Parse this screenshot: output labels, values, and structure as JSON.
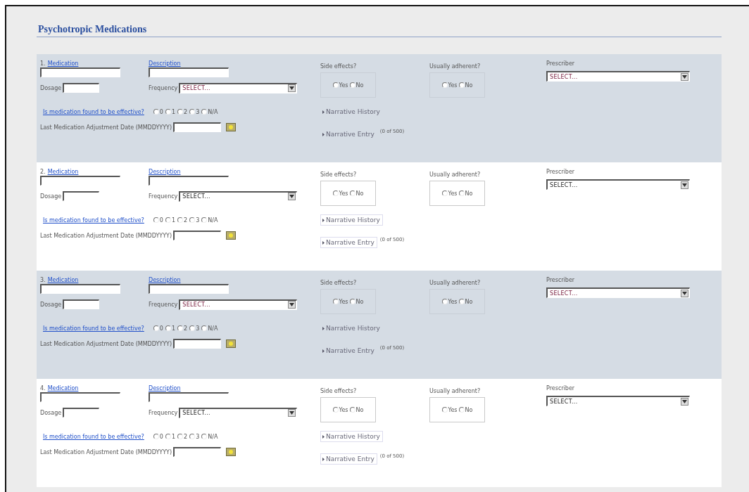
{
  "title": "Psychotropic Medications",
  "rows": [
    {
      "number": "1.",
      "shaded": true,
      "medication_label": "Medication",
      "description_label": "Description",
      "dosage_label": "Dosage",
      "frequency_label": "Frequency",
      "frequency_value": "SELECT...",
      "effective_question": "Is medication found to be effective?",
      "effective_options": [
        {
          "label": "0",
          "selected": false
        },
        {
          "label": "1",
          "selected": false
        },
        {
          "label": "2",
          "selected": false
        },
        {
          "label": "3",
          "selected": false
        },
        {
          "label": "N/A",
          "selected": false
        }
      ],
      "date_label": "Last Medication Adjustment Date (MMDDYYYY)",
      "side_effects_label": "Side effects?",
      "side_effects_options": [
        {
          "label": "Yes",
          "selected": false
        },
        {
          "label": "No",
          "selected": false
        }
      ],
      "adherent_label": "Usually adherent?",
      "adherent_options": [
        {
          "label": "Yes",
          "selected": false
        },
        {
          "label": "No",
          "selected": false
        }
      ],
      "prescriber_label": "Prescriber",
      "prescriber_value": "SELECT...",
      "narrative_history": "Narrative History",
      "narrative_entry": "Narrative Entry",
      "entry_count": "(0 of 500)"
    },
    {
      "number": "2.",
      "shaded": false,
      "medication_label": "Medication",
      "description_label": "Description",
      "dosage_label": "Dosage",
      "frequency_label": "Frequency",
      "frequency_value": "SELECT...",
      "effective_question": "Is medication found to be effective?",
      "effective_options": [
        {
          "label": "0",
          "selected": false
        },
        {
          "label": "1",
          "selected": false
        },
        {
          "label": "2",
          "selected": false
        },
        {
          "label": "3",
          "selected": false
        },
        {
          "label": "N/A",
          "selected": false
        }
      ],
      "date_label": "Last Medication Adjustment Date (MMDDYYYY)",
      "side_effects_label": "Side effects?",
      "side_effects_options": [
        {
          "label": "Yes",
          "selected": false
        },
        {
          "label": "No",
          "selected": false
        }
      ],
      "adherent_label": "Usually adherent?",
      "adherent_options": [
        {
          "label": "Yes",
          "selected": false
        },
        {
          "label": "No",
          "selected": false
        }
      ],
      "prescriber_label": "Prescriber",
      "prescriber_value": "SELECT...",
      "narrative_history": "Narrative History",
      "narrative_entry": "Narrative Entry",
      "entry_count": "(0 of 500)"
    },
    {
      "number": "3.",
      "shaded": true,
      "medication_label": "Medication",
      "description_label": "Description",
      "dosage_label": "Dosage",
      "frequency_label": "Frequency",
      "frequency_value": "SELECT...",
      "effective_question": "Is medication found to be effective?",
      "effective_options": [
        {
          "label": "0",
          "selected": false
        },
        {
          "label": "1",
          "selected": false
        },
        {
          "label": "2",
          "selected": false
        },
        {
          "label": "3",
          "selected": false
        },
        {
          "label": "N/A",
          "selected": false
        }
      ],
      "date_label": "Last Medication Adjustment Date (MMDDYYYY)",
      "side_effects_label": "Side effects?",
      "side_effects_options": [
        {
          "label": "Yes",
          "selected": false
        },
        {
          "label": "No",
          "selected": false
        }
      ],
      "adherent_label": "Usually adherent?",
      "adherent_options": [
        {
          "label": "Yes",
          "selected": false
        },
        {
          "label": "No",
          "selected": false
        }
      ],
      "prescriber_label": "Prescriber",
      "prescriber_value": "SELECT...",
      "narrative_history": "Narrative History",
      "narrative_entry": "Narrative Entry",
      "entry_count": "(0 of 500)"
    },
    {
      "number": "4.",
      "shaded": false,
      "medication_label": "Medication",
      "description_label": "Description",
      "dosage_label": "Dosage",
      "frequency_label": "Frequency",
      "frequency_value": "SELECT...",
      "effective_question": "Is medication found to be effective?",
      "effective_options": [
        {
          "label": "0",
          "selected": false
        },
        {
          "label": "1",
          "selected": false
        },
        {
          "label": "2",
          "selected": false
        },
        {
          "label": "3",
          "selected": false
        },
        {
          "label": "N/A",
          "selected": false
        }
      ],
      "date_label": "Last Medication Adjustment Date (MMDDYYYY)",
      "side_effects_label": "Side effects?",
      "side_effects_options": [
        {
          "label": "Yes",
          "selected": false
        },
        {
          "label": "No",
          "selected": false
        }
      ],
      "adherent_label": "Usually adherent?",
      "adherent_options": [
        {
          "label": "Yes",
          "selected": false
        },
        {
          "label": "No",
          "selected": false
        }
      ],
      "prescriber_label": "Prescriber",
      "prescriber_value": "SELECT...",
      "narrative_history": "Narrative History",
      "narrative_entry": "Narrative Entry",
      "entry_count": "(0 of 500)"
    }
  ]
}
